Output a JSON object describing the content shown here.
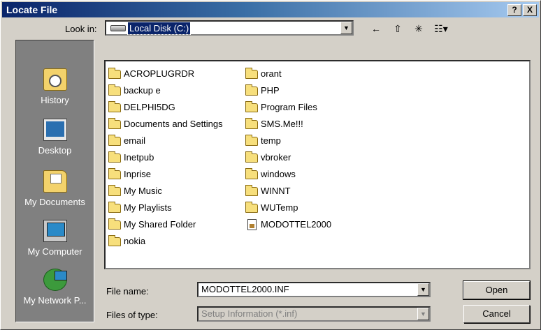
{
  "window": {
    "title": "Locate File",
    "help_label": "?",
    "close_label": "X"
  },
  "lookin": {
    "label": "Look in:",
    "value": "Local Disk (C:)",
    "arrow": "▼"
  },
  "toolbar": {
    "back_icon": "←",
    "up_icon": "⇧",
    "new_folder_icon": "✳",
    "views_icon": "☷▾"
  },
  "places": [
    {
      "label": "History",
      "icon": "history-icon"
    },
    {
      "label": "Desktop",
      "icon": "desktop-icon"
    },
    {
      "label": "My Documents",
      "icon": "my-documents-icon"
    },
    {
      "label": "My Computer",
      "icon": "my-computer-icon"
    },
    {
      "label": "My Network P...",
      "icon": "my-network-icon"
    }
  ],
  "files": {
    "column1": [
      "ACROPLUGRDR",
      "backup e",
      "DELPHI5DG",
      "Documents and Settings",
      "email",
      "Inetpub",
      "Inprise",
      "My Music",
      "My Playlists",
      "My Shared Folder",
      "nokia"
    ],
    "column2": [
      "orant",
      "PHP",
      "Program Files",
      "SMS.Me!!!",
      "temp",
      "vbroker",
      "windows",
      "WINNT",
      "WUTemp"
    ],
    "file_item": "MODOTTEL2000"
  },
  "filename": {
    "label": "File name:",
    "value": "MODOTTEL2000.INF"
  },
  "filetype": {
    "label": "Files of type:",
    "value": "Setup Information (*.inf)"
  },
  "buttons": {
    "open": "Open",
    "cancel": "Cancel"
  }
}
